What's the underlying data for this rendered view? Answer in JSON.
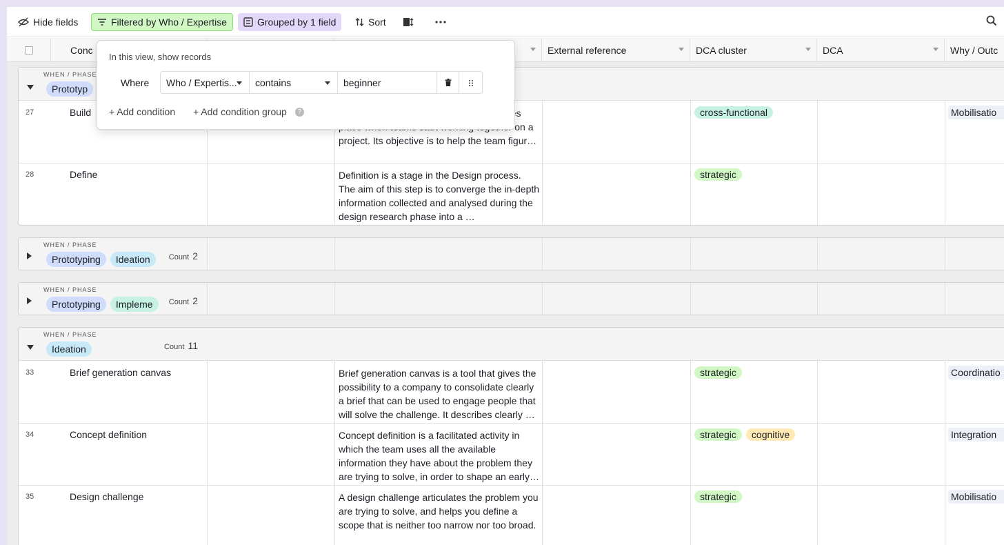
{
  "toolbar": {
    "hide_fields": "Hide fields",
    "filter": "Filtered by Who / Expertise",
    "group": "Grouped by 1 field",
    "sort": "Sort",
    "filter_color": "#d1f7c4",
    "group_color": "#e2d9fa"
  },
  "columns": {
    "primary": "Conc",
    "col3": "",
    "external": "External reference",
    "cluster": "DCA cluster",
    "dca": "DCA",
    "why": "Why / Outc"
  },
  "popover": {
    "title": "In this view, show records",
    "where": "Where",
    "field": "Who / Expertis...",
    "operator": "contains",
    "value": "beginner",
    "add_condition": "+ Add condition",
    "add_group": "+ Add condition group"
  },
  "groups": [
    {
      "label": "WHEN / PHASE",
      "chips": [
        "Prototyp"
      ],
      "count_label": "",
      "count": "",
      "rows": [
        {
          "num": "27",
          "name": "Build",
          "notes": "ser, team building activity that usually takes place when teams start working together on a project. Its objective is to help the team figur…",
          "clusters": [
            "cross-functional"
          ],
          "why": "Mobilisatio"
        },
        {
          "num": "28",
          "name": "Define",
          "notes": "Definition is a stage in the Design process. The aim of this step is to converge the in-depth information collected and analysed during the design research phase into a …",
          "clusters": [
            "strategic"
          ],
          "why": ""
        }
      ]
    },
    {
      "label": "WHEN / PHASE",
      "chips": [
        "Prototyping",
        "Ideation"
      ],
      "count_label": "Count",
      "count": "2",
      "rows": []
    },
    {
      "label": "WHEN / PHASE",
      "chips": [
        "Prototyping",
        "Impleme"
      ],
      "count_label": "Count",
      "count": "2",
      "rows": []
    },
    {
      "label": "WHEN / PHASE",
      "chips": [
        "Ideation"
      ],
      "count_label": "Count",
      "count": "11",
      "rows": [
        {
          "num": "33",
          "name": "Brief generation canvas",
          "notes": "Brief generation canvas is a tool that gives the possibility to a company to consolidate clearly a brief that can be used to engage people that will solve the challenge. It describes clearly …",
          "clusters": [
            "strategic"
          ],
          "why": "Coordinatio"
        },
        {
          "num": "34",
          "name": "Concept definition",
          "notes": "Concept definition is a facilitated activity in which the team uses all the available information they have about the problem they are trying to solve, in order to shape an early…",
          "clusters": [
            "strategic",
            "cognitive"
          ],
          "why": "Integration"
        },
        {
          "num": "35",
          "name": "Design challenge",
          "notes": "A design challenge articulates the problem you are trying to solve, and helps you define a scope that is neither too narrow nor too broad.",
          "clusters": [
            "strategic"
          ],
          "why": "Mobilisatio"
        }
      ]
    }
  ],
  "chip_colors": {
    "Prototyping": "#cfdcfb",
    "Prototyp": "#cfdcfb",
    "Ideation": "#c8e9f8",
    "Impleme": "#c7f2e3",
    "cross-functional": "#c7f2e3",
    "strategic": "#d1f7c4",
    "cognitive": "#ffeab6"
  }
}
